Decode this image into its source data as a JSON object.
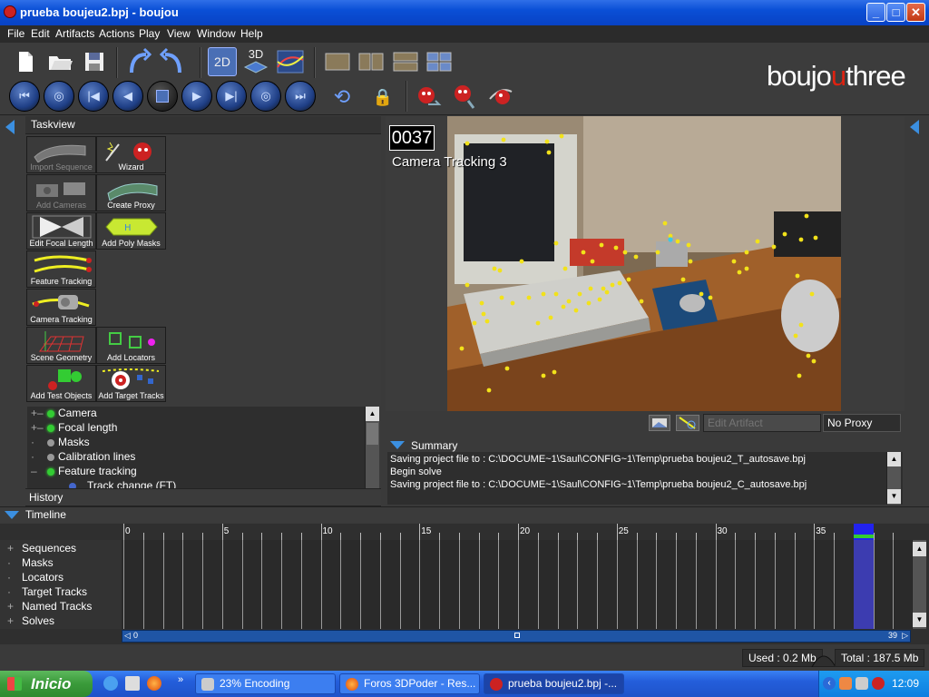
{
  "window": {
    "title": "prueba boujeu2.bpj - boujou",
    "minimize": "_",
    "maximize": "□",
    "close": "✕"
  },
  "menu": [
    "File",
    "Edit",
    "Artifacts",
    "Actions",
    "Play",
    "View",
    "Window",
    "Help"
  ],
  "toolbar": {
    "view_2d": "2D",
    "view_3d": "3D"
  },
  "logo": {
    "left": "boujo",
    "u": "u",
    "right": "three"
  },
  "taskview": {
    "title": "Taskview",
    "buttons": [
      {
        "label": "Import Sequence",
        "enabled": false
      },
      {
        "label": "Wizard",
        "enabled": true
      },
      {
        "label": "Add Cameras",
        "enabled": false
      },
      {
        "label": "Create Proxy",
        "enabled": true
      },
      {
        "label": "Edit Focal Length",
        "enabled": true
      },
      {
        "label": "Add Poly Masks",
        "enabled": true
      },
      {
        "label": "Feature Tracking",
        "enabled": true
      },
      {
        "label": "Camera Tracking",
        "enabled": true
      },
      {
        "label": "Scene Geometry",
        "enabled": true
      },
      {
        "label": "Add Locators",
        "enabled": true
      },
      {
        "label": "Add Test Objects",
        "enabled": true
      },
      {
        "label": "Add Target Tracks",
        "enabled": true
      }
    ]
  },
  "tree": [
    {
      "label": "Camera",
      "status": "green"
    },
    {
      "label": "Focal length",
      "status": "green"
    },
    {
      "label": "Masks",
      "status": "grey"
    },
    {
      "label": "Calibration lines",
      "status": "grey"
    },
    {
      "label": "Feature tracking",
      "status": "green"
    },
    {
      "label": "Track change (FT)",
      "status": "info"
    }
  ],
  "history": {
    "title": "History"
  },
  "viewer": {
    "frame_number": "0037",
    "overlay_label": "Camera Tracking 3",
    "artifact_placeholder": "Edit Artifact",
    "proxy": "No Proxy"
  },
  "summary": {
    "title": "Summary",
    "lines": [
      "Saving project file to : C:\\DOCUME~1\\Saul\\CONFIG~1\\Temp\\prueba boujeu2_T_autosave.bpj",
      "Begin solve",
      "Saving project file to : C:\\DOCUME~1\\Saul\\CONFIG~1\\Temp\\prueba boujeu2_C_autosave.bpj"
    ]
  },
  "timeline": {
    "title": "Timeline",
    "rows": [
      {
        "label": "Sequences",
        "expandable": true
      },
      {
        "label": "Masks",
        "expandable": false
      },
      {
        "label": "Locators",
        "expandable": false
      },
      {
        "label": "Target Tracks",
        "expandable": false
      },
      {
        "label": "Named Tracks",
        "expandable": true
      },
      {
        "label": "Solves",
        "expandable": true
      }
    ],
    "ruler_labels": [
      "0",
      "5",
      "10",
      "15",
      "20",
      "25",
      "30",
      "35"
    ],
    "frame_count": 39,
    "current_frame": 37,
    "range_start": "0",
    "range_end": "39"
  },
  "status": {
    "used": "Used : 0.2 Mb",
    "total": "Total : 187.5 Mb"
  },
  "taskbar": {
    "start": "Inicio",
    "tasks": [
      {
        "label": "23% Encoding",
        "active": false
      },
      {
        "label": "Foros 3DPoder - Res...",
        "active": false
      },
      {
        "label": "prueba boujeu2.bpj -...",
        "active": true
      }
    ],
    "clock": "12:09"
  },
  "colors": {
    "tracker_point": "#f2e21a",
    "accent_blue": "#1f55a5",
    "logo_u": "#dd2211"
  }
}
